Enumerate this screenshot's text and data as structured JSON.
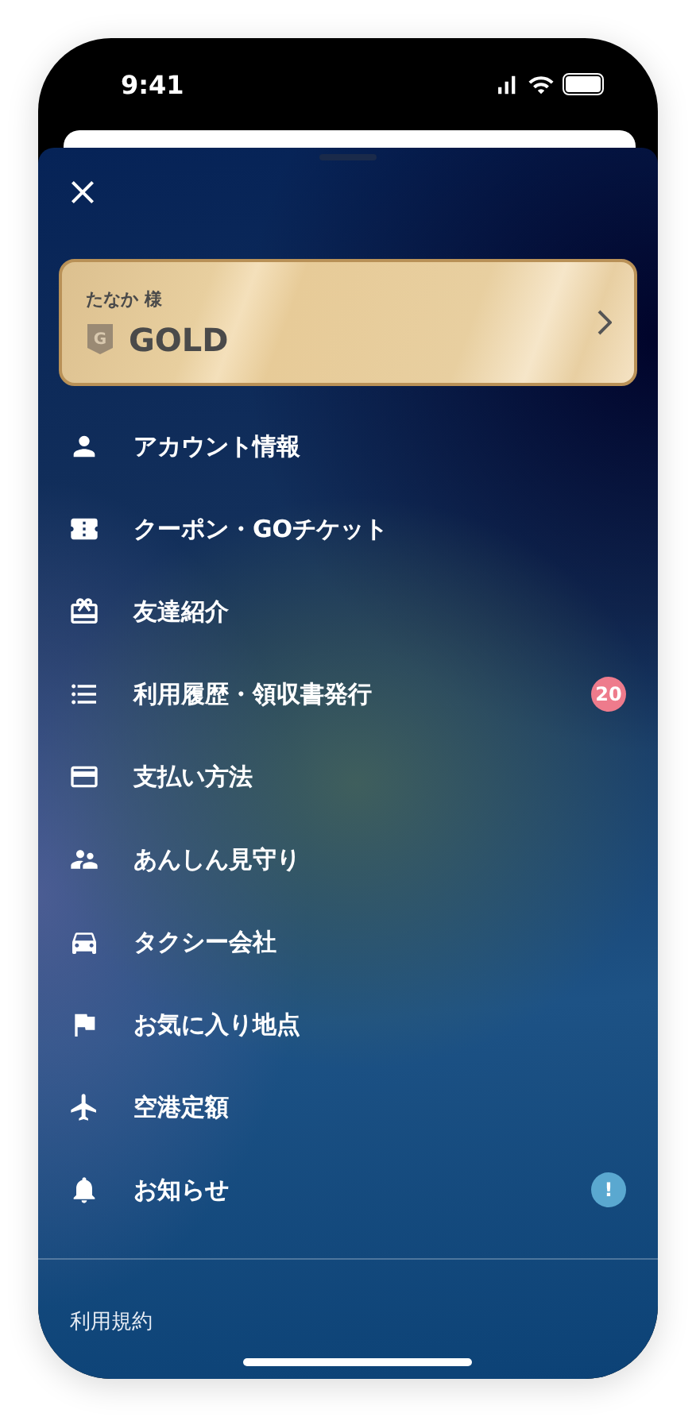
{
  "status_bar": {
    "time": "9:41"
  },
  "member_card": {
    "name": "たなか 様",
    "tier_badge": "G",
    "tier": "GOLD"
  },
  "menu": [
    {
      "label": "アカウント情報"
    },
    {
      "label": "クーポン・GOチケット"
    },
    {
      "label": "友達紹介"
    },
    {
      "label": "利用履歴・領収書発行",
      "badge": {
        "text": "20",
        "color": "#ee7b8c"
      }
    },
    {
      "label": "支払い方法"
    },
    {
      "label": "あんしん見守り"
    },
    {
      "label": "タクシー会社"
    },
    {
      "label": "お気に入り地点"
    },
    {
      "label": "空港定額"
    },
    {
      "label": "お知らせ",
      "badge": {
        "text": "!",
        "color": "#5aa8d0"
      }
    }
  ],
  "footer_links": [
    "利用規約"
  ]
}
